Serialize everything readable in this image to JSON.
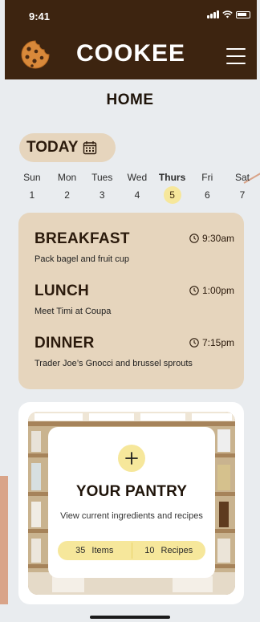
{
  "status": {
    "time": "9:41"
  },
  "header": {
    "app_title": "COOKEE",
    "logo_icon": "cookie-icon",
    "menu_icon": "hamburger-menu-icon"
  },
  "page": {
    "title": "HOME"
  },
  "today": {
    "label": "TODAY",
    "icon": "calendar-icon"
  },
  "week": {
    "days": [
      {
        "name": "Sun",
        "num": "1"
      },
      {
        "name": "Mon",
        "num": "2"
      },
      {
        "name": "Tues",
        "num": "3"
      },
      {
        "name": "Wed",
        "num": "4"
      },
      {
        "name": "Thurs",
        "num": "5"
      },
      {
        "name": "Fri",
        "num": "6"
      },
      {
        "name": "Sat",
        "num": "7"
      }
    ],
    "selected": "Thurs"
  },
  "meals": [
    {
      "title": "BREAKFAST",
      "time": "9:30am",
      "desc": "Pack bagel and fruit cup"
    },
    {
      "title": "LUNCH",
      "time": "1:00pm",
      "desc": "Meet Timi at Coupa"
    },
    {
      "title": "DINNER",
      "time": "7:15pm",
      "desc": "Trader Joe’s Gnocci and brussel sprouts"
    }
  ],
  "pantry": {
    "title": "YOUR PANTRY",
    "subtitle": "View current ingredients and recipes",
    "items_count": "35",
    "items_label": "Items",
    "recipes_count": "10",
    "recipes_label": "Recipes",
    "add_icon": "plus-icon"
  },
  "colors": {
    "header_bg": "#3d2410",
    "card_beige": "#e6d5bd",
    "accent_yellow": "#f6e79b",
    "page_bg": "#e9ecef"
  }
}
